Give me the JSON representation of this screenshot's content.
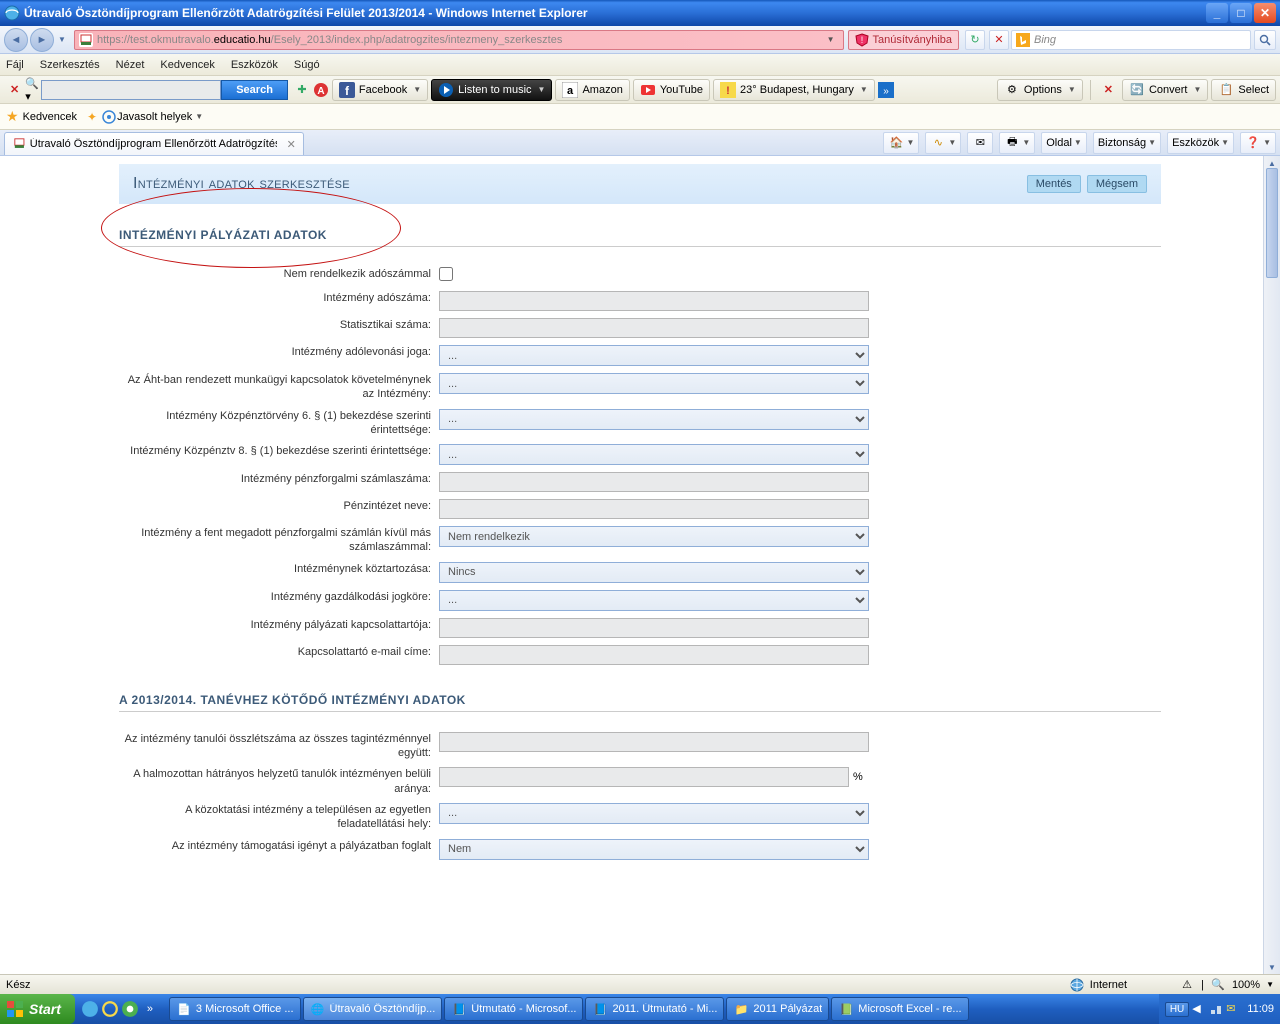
{
  "window": {
    "title": "Útravaló Ösztöndíjprogram Ellenőrzött Adatrögzítési Felület 2013/2014 - Windows Internet Explorer"
  },
  "nav": {
    "url_faint1": "https://test.okmutravalo.",
    "url_bold": "educatio.hu",
    "url_faint2": "/Esely_2013/index.php/adatrogzites/intezmeny_szerkesztes",
    "cert_error": "Tanúsítványhiba",
    "search_placeholder": "Bing"
  },
  "menu": {
    "file": "Fájl",
    "edit": "Szerkesztés",
    "view": "Nézet",
    "fav": "Kedvencek",
    "tools": "Eszközök",
    "help": "Súgó"
  },
  "toolbar": {
    "search_btn": "Search",
    "facebook": "Facebook",
    "listen": "Listen to music",
    "amazon": "Amazon",
    "youtube": "YouTube",
    "weather": "23° Budapest, Hungary",
    "options": "Options",
    "convert": "Convert",
    "select": "Select"
  },
  "favbar": {
    "label": "Kedvencek",
    "suggested": "Javasolt helyek"
  },
  "tab": {
    "title": "Útravaló Ösztöndíjprogram Ellenőrzött Adatrögzítési F..."
  },
  "cmdbar": {
    "page": "Oldal",
    "safety": "Biztonság",
    "tools": "Eszközök"
  },
  "form": {
    "heading": "Intézményi adatok szerkesztése",
    "save": "Mentés",
    "cancel": "Mégsem",
    "section1": "INTÉZMÉNYI PÁLYÁZATI ADATOK",
    "rows": {
      "no_tax": "Nem rendelkezik adószámmal",
      "tax_no": "Intézmény adószáma:",
      "stat_no": "Statisztikai száma:",
      "tax_ded": "Intézmény adólevonási joga:",
      "aht": "Az Áht-ban rendezett munkaügyi kapcsolatok követelménynek az Intézmény:",
      "kozp6": "Intézmény Közpénztörvény 6. § (1) bekezdése szerinti érintettsége:",
      "kozp8": "Intézmény Közpénztv 8. § (1) bekezdése szerinti érintettsége:",
      "bank": "Intézmény pénzforgalmi számlaszáma:",
      "bankname": "Pénzintézet neve:",
      "otheracc": "Intézmény a fent megadott pénzforgalmi számlán kívül más számlaszámmal:",
      "debt": "Intézménynek köztartozása:",
      "econ": "Intézmény gazdálkodási jogköre:",
      "contact": "Intézmény pályázati kapcsolattartója:",
      "email": "Kapcsolattartó e-mail címe:"
    },
    "section2": "A 2013/2014. TANÉVHEZ KÖTŐDŐ INTÉZMÉNYI ADATOK",
    "rows2": {
      "total": "Az intézmény tanulói összlétszáma az összes tagintézménnyel együtt:",
      "ratio": "A halmozottan hátrányos helyzetű tanulók intézményen belüli aránya:",
      "single": "A közoktatási intézmény a településen az egyetlen feladatellátási hely:",
      "support": "Az intézmény támogatási igényt a pályázatban foglalt"
    },
    "opts": {
      "placeholder": "...",
      "nem_rendelkezik": "Nem rendelkezik",
      "nincs": "Nincs",
      "nem": "Nem"
    }
  },
  "status": {
    "ready": "Kész",
    "zone": "Internet",
    "zoom": "100%"
  },
  "taskbar": {
    "start": "Start",
    "items": [
      "3 Microsoft Office ...",
      "Útravaló Ösztöndíjp...",
      "Útmutató - Microsof...",
      "2011. Útmutató - Mi...",
      "2011 Pályázat",
      "Microsoft Excel - re..."
    ],
    "lang": "HU",
    "clock": "11:09"
  }
}
